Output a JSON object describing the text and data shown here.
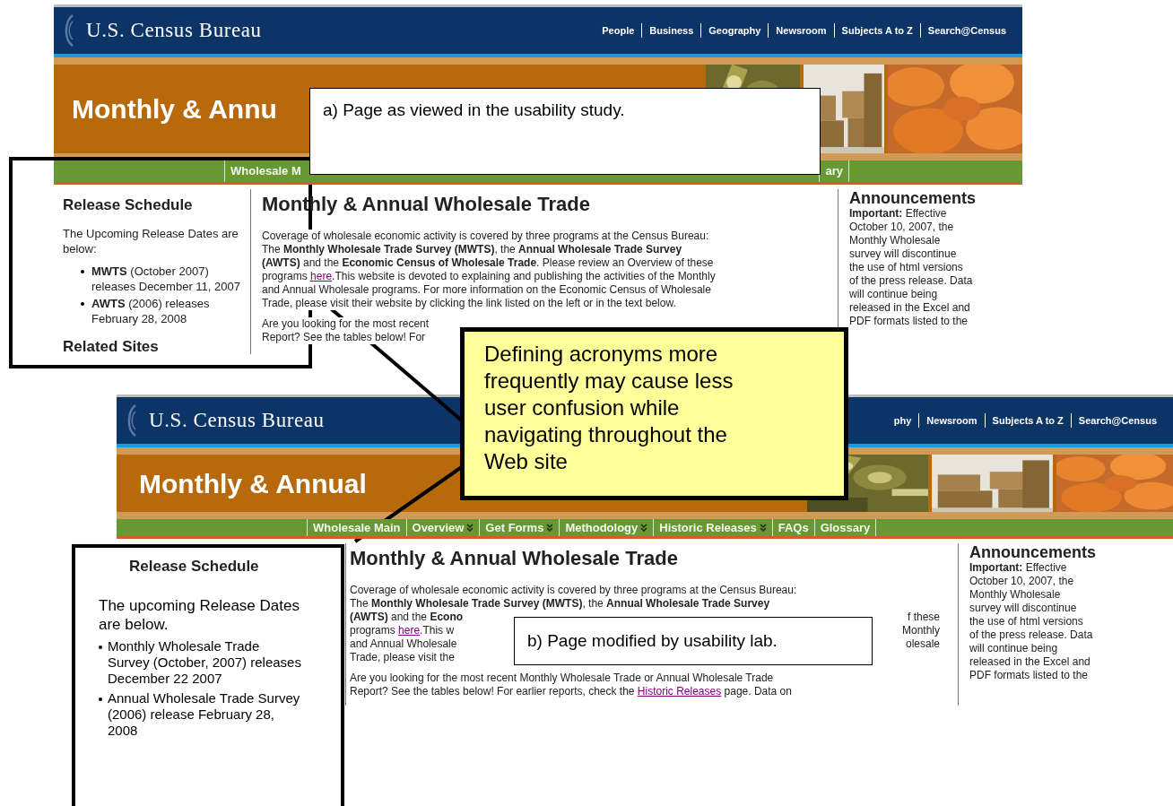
{
  "panels": [
    {
      "top_links": [
        "People",
        "Business",
        "Geography",
        "Newsroom",
        "Subjects A to Z",
        "Search@Census"
      ],
      "site_title": "U.S. Census Bureau",
      "banner_title": "Monthly & Annu",
      "nav": [
        {
          "label": "Wholesale M",
          "menu": false
        },
        {
          "label": "ary",
          "menu": false
        }
      ],
      "left_column": {
        "heading": "Release Schedule",
        "intro": "The Upcoming Release Dates are below:",
        "items": [
          "**MWTS** (October 2007) releases December 11, 2007",
          "**AWTS** (2006) releases February 28, 2008"
        ],
        "next_heading": "Related Sites"
      },
      "main": {
        "heading": "Monthly & Annual Wholesale Trade",
        "paragraphs": [
          [
            {
              "text": "Coverage of wholesale economic activity is covered by three programs at the Census Bureau:"
            },
            {
              "text": "The **Monthly Wholesale Trade Survey (MWTS)**, the **Annual Wholesale Trade Survey**"
            },
            {
              "text": "**(AWTS)** and the **Economic Census of Wholesale Trade**. Please review an Overview of these"
            },
            {
              "text": "programs ",
              "link": "here",
              "rest": ".This website is devoted to explaining and publishing the activities of the Monthly"
            },
            {
              "text": "and Annual Wholesale programs. For more information on the Economic Census of Wholesale"
            },
            {
              "text": "Trade, please visit their website by clicking the link listed on the left or in the text below."
            }
          ],
          [
            {
              "text": "Are you looking for the most recent"
            },
            {
              "text": "Report? See the tables below! For"
            }
          ]
        ]
      },
      "announcements": {
        "heading": "Announcements",
        "lines": [
          "**Important:** Effective",
          "October 10, 2007, the",
          "Monthly Wholesale",
          "survey will discontinue",
          "the use of html versions",
          "of the press release. Data",
          "will continue being",
          "released in the Excel and",
          "PDF formats listed to the"
        ]
      }
    },
    {
      "top_links": [
        "phy",
        "Newsroom",
        "Subjects A to Z",
        "Search@Census"
      ],
      "site_title": "U.S. Census Bureau",
      "banner_title": "Monthly & Annual",
      "nav": [
        {
          "label": "Wholesale Main",
          "menu": false
        },
        {
          "label": "Overview",
          "menu": true
        },
        {
          "label": "Get Forms",
          "menu": true
        },
        {
          "label": "Methodology",
          "menu": true
        },
        {
          "label": "Historic Releases",
          "menu": true
        },
        {
          "label": "FAQs",
          "menu": false
        },
        {
          "label": "Glossary",
          "menu": false
        }
      ],
      "main": {
        "heading": "Monthly & Annual Wholesale Trade",
        "paragraphs": [
          [
            {
              "text": "Coverage of wholesale economic activity is covered by three programs at the Census Bureau:"
            },
            {
              "text": "The **Monthly Wholesale Trade Survey (MWTS)**, the **Annual Wholesale Trade Survey**"
            },
            {
              "text": "**(AWTS)** and the **Econo**",
              "right": "f these"
            },
            {
              "text": "programs ",
              "link": "here",
              "rest": ".This w",
              "right": "Monthly"
            },
            {
              "text": "and Annual Wholesale",
              "right": "olesale"
            },
            {
              "text": "Trade, please visit the"
            }
          ],
          [
            {
              "text": "Are you looking for the most recent Monthly Wholesale Trade or Annual Wholesale Trade"
            },
            {
              "text": "Report? See the tables below! For earlier reports, check the ",
              "link": "Historic Releases",
              "rest": " page. Data on"
            }
          ]
        ]
      },
      "announcements": {
        "heading": "Announcements",
        "lines": [
          "**Important:** Effective",
          "October 10, 2007, the",
          "Monthly Wholesale",
          "survey will discontinue",
          "the use of html versions",
          "of the press release. Data",
          "will continue being",
          "released in the Excel and",
          "PDF formats listed to the"
        ]
      }
    }
  ],
  "caption_a": "a) Page as viewed in the usability study.",
  "caption_b": "b) Page modified by usability lab.",
  "callout": "Defining acronyms more frequently may cause less user confusion while navigating throughout the Web site",
  "modified_release_schedule": {
    "heading": "Release Schedule",
    "intro": "The upcoming Release Dates are below.",
    "items": [
      "Monthly Wholesale Trade Survey (October, 2007) releases December 22 2007",
      "Annual Wholesale Trade Survey (2006) release February 28, 2008"
    ]
  }
}
